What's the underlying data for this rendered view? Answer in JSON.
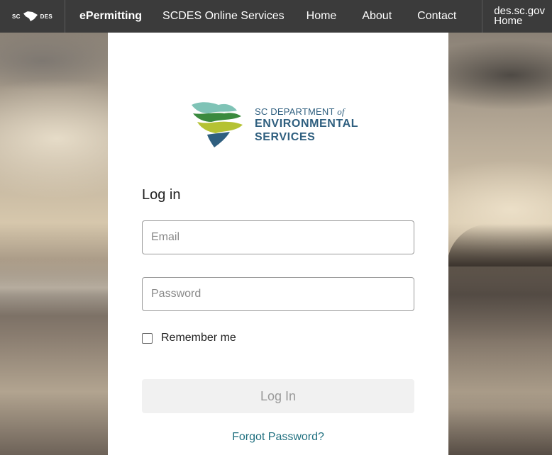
{
  "topbar": {
    "logo_left": "SC",
    "logo_right": "DES",
    "app_name": "ePermitting",
    "app_subtitle": "SCDES Online Services",
    "nav": [
      {
        "label": "Home"
      },
      {
        "label": "About"
      },
      {
        "label": "Contact"
      }
    ],
    "external_home_line1": "des.sc.gov",
    "external_home_line2": "Home",
    "background_color": "#3b3b3b"
  },
  "logo": {
    "line1": "SC DEPARTMENT",
    "line1_of": "of",
    "line2": "ENVIRONMENTAL",
    "line3": "SERVICES",
    "colors": {
      "teal": "#7fc3b6",
      "green": "#3a8a3e",
      "lime": "#b5c233",
      "blue": "#2f5f7f"
    }
  },
  "login": {
    "heading": "Log in",
    "email_placeholder": "Email",
    "password_placeholder": "Password",
    "remember_label": "Remember me",
    "remember_checked": false,
    "submit_label": "Log In",
    "forgot_label": "Forgot Password?",
    "link_color": "#1f6f7f"
  }
}
